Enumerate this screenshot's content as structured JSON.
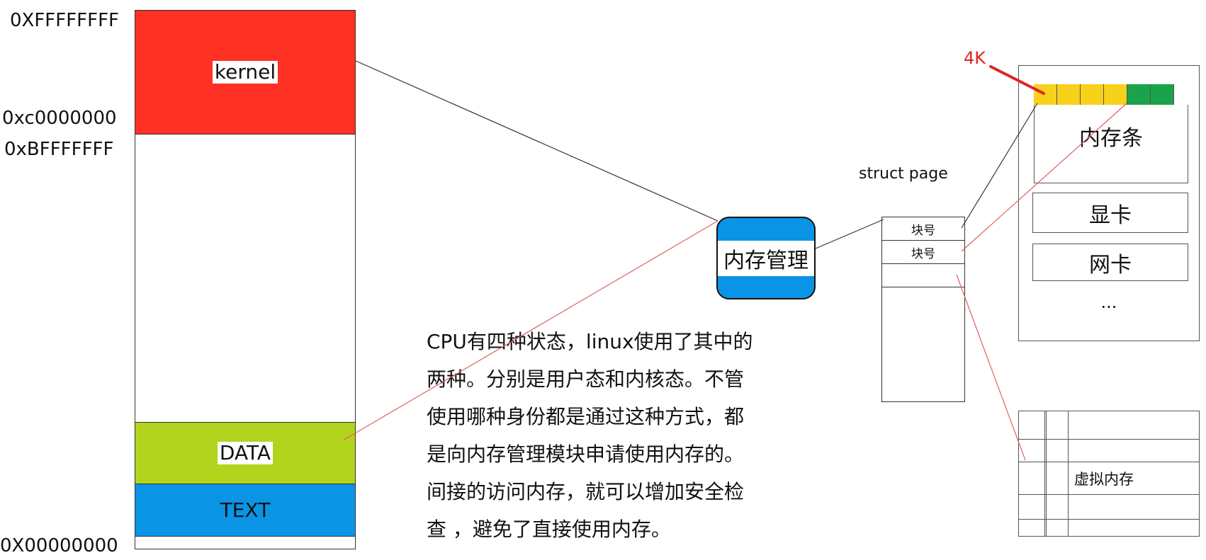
{
  "addresses": {
    "top": "0XFFFFFFFF",
    "kernel_start": "0xc0000000",
    "user_top": "0xBFFFFFFF",
    "bottom": "0X00000000"
  },
  "segments": {
    "kernel": {
      "label": "kernel",
      "color": "#ff3024"
    },
    "data": {
      "label": "DATA",
      "color": "#b3d41c"
    },
    "text": {
      "label": "TEXT",
      "color": "#0a94e6"
    }
  },
  "memory_manager": {
    "label": "内存管理",
    "color": "#0a94e6"
  },
  "description": {
    "lines": [
      "CPU有四种状态，linux使用了其中的",
      "两种。分别是用户态和内核态。不管",
      "使用哪种身份都是通过这种方式，都",
      "是向内存管理模块申请使用内存的。",
      "间接的访问内存，就可以增加安全检",
      "查 ，避免了直接使用内存。"
    ]
  },
  "struct_page": {
    "title": "struct page",
    "rows": [
      "块号",
      "块号",
      "",
      ""
    ]
  },
  "hardware": {
    "memory_stick": "内存条",
    "graphics_card": "显卡",
    "network_card": "网卡",
    "more": "..."
  },
  "block_size_label": "4K",
  "virtual_memory": {
    "label": "虚拟内存"
  },
  "colors": {
    "page_yellow": "#f7d11a",
    "page_green": "#1aa34a",
    "annotation_red": "#e02424",
    "thin_red_line": "#e06060"
  }
}
